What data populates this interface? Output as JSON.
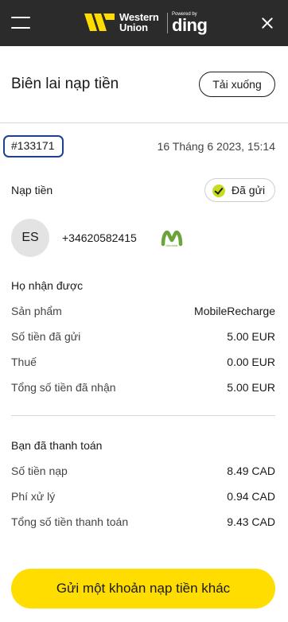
{
  "header": {
    "brand_line1": "Western",
    "brand_line2": "Union",
    "powered_by": "Powered by",
    "partner": "ding",
    "menu_icon": "hamburger-icon",
    "close_icon": "close-icon"
  },
  "receipt": {
    "title": "Biên lai nạp tiền",
    "download_label": "Tải xuống",
    "order_id": "#133171",
    "date": "16 Tháng 6 2023, 15:14",
    "type_label": "Nạp tiền",
    "status": "Đã gửi",
    "recipient_initials": "ES",
    "phone": "+34620582415",
    "operator_brand": "Movistar"
  },
  "received": {
    "title": "Họ nhận được",
    "rows": [
      {
        "label": "Sản phẩm",
        "value": "MobileRecharge"
      },
      {
        "label": "Số tiền đã gửi",
        "value": "5.00 EUR"
      },
      {
        "label": "Thuế",
        "value": "0.00 EUR"
      },
      {
        "label": "Tổng số tiền đã nhận",
        "value": "5.00 EUR"
      }
    ]
  },
  "paid": {
    "title": "Bạn đã thanh toán",
    "rows": [
      {
        "label": "Số tiền nạp",
        "value": "8.49 CAD"
      },
      {
        "label": "Phí xử lý",
        "value": "0.94 CAD"
      },
      {
        "label": "Tổng số tiền thanh toán",
        "value": "9.43 CAD"
      }
    ]
  },
  "cta": {
    "label": "Gửi một khoản nạp tiền khác"
  },
  "colors": {
    "header_bg": "#2b2b2b",
    "brand_yellow": "#ffdd00",
    "status_check": "#c7dc1f",
    "highlight_border": "#1f3f8f",
    "operator_green": "#6aa43a"
  }
}
